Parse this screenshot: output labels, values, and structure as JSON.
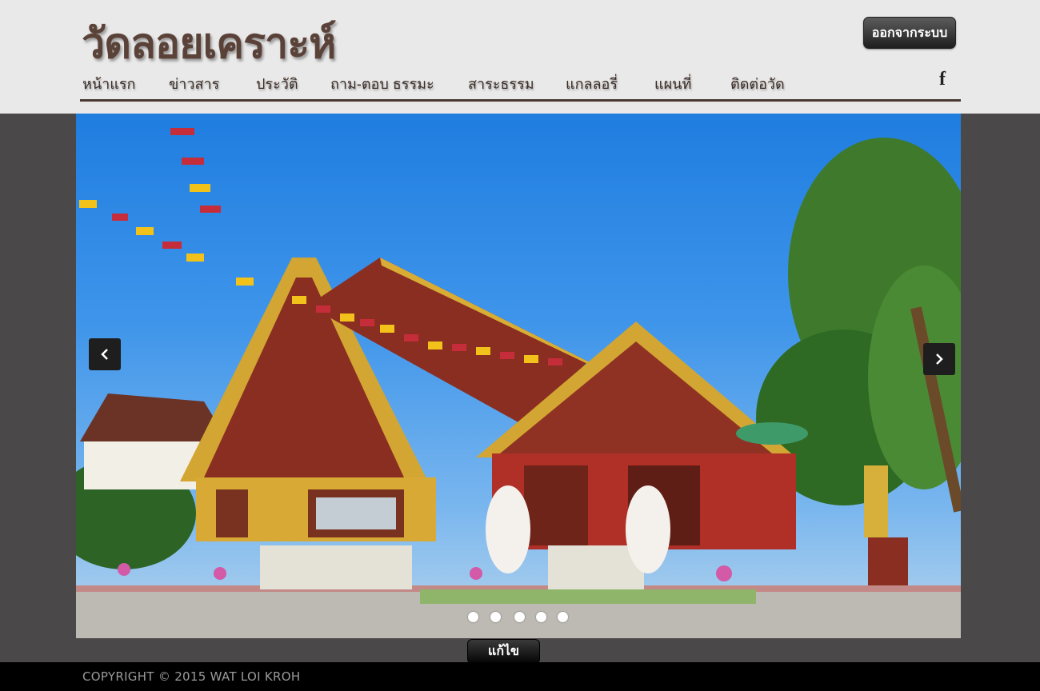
{
  "header": {
    "site_title": "วัดลอยเคราะห์",
    "logout_label": "ออกจากระบบ"
  },
  "nav": {
    "items": [
      {
        "label": "หน้าแรก"
      },
      {
        "label": "ข่าวสาร"
      },
      {
        "label": "ประวัติ"
      },
      {
        "label": "ถาม-ตอบ ธรรมะ"
      },
      {
        "label": "สาระธรรม"
      },
      {
        "label": "แกลลอรี่"
      },
      {
        "label": "แผนที่"
      },
      {
        "label": "ติดต่อวัด"
      }
    ],
    "social_icon": "facebook-icon",
    "social_glyph": "f"
  },
  "slider": {
    "image": "temple-photo",
    "slide_count": 5,
    "active_slide": 1,
    "prev_icon": "chevron-left-icon",
    "next_icon": "chevron-right-icon"
  },
  "edit_label": "แก้ไข",
  "footer": {
    "copyright": "COPYRIGHT © 2015 WAT LOI KROH"
  },
  "colors": {
    "header_bg": "#e9e9e9",
    "title": "#5a4238",
    "page_bg": "#4a4848",
    "footer_bg": "#000000",
    "gold": "#d4a62a",
    "roof": "#8a2e22"
  }
}
